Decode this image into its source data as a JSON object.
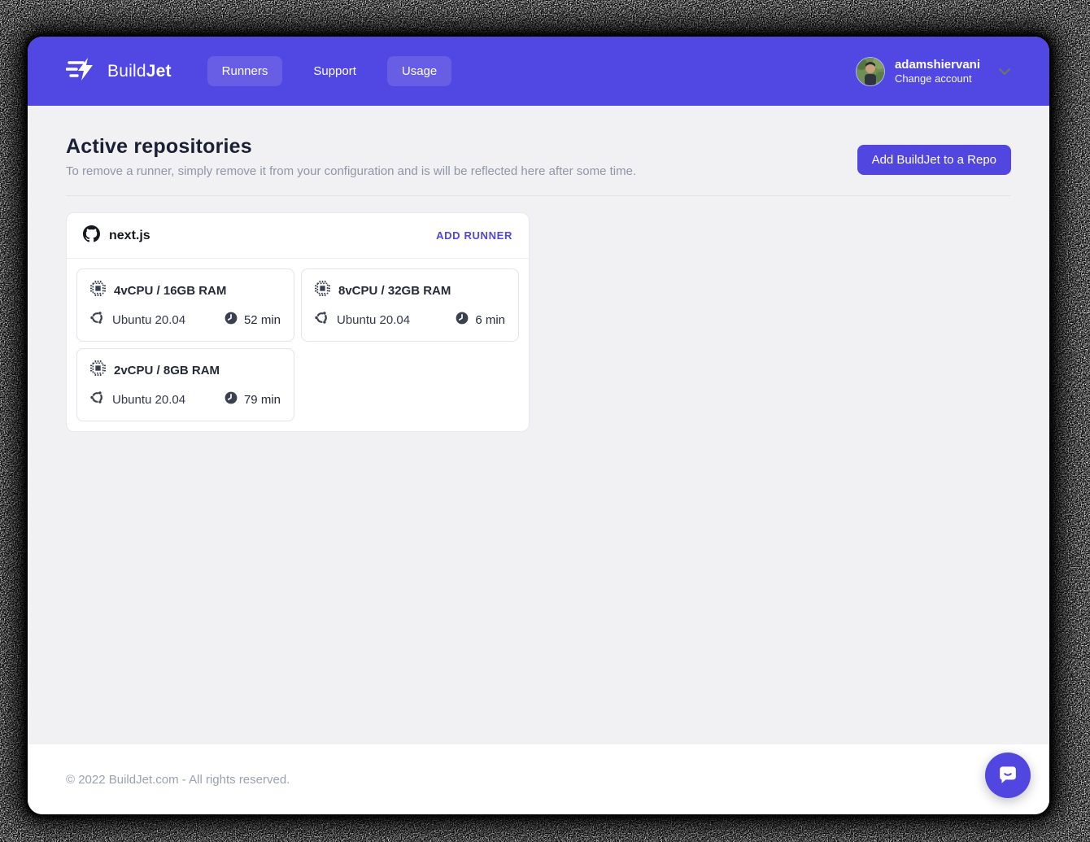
{
  "navbar": {
    "brand": {
      "light": "Build",
      "bold": "Jet"
    },
    "items": [
      {
        "label": "Runners",
        "active": true
      },
      {
        "label": "Support",
        "active": false
      },
      {
        "label": "Usage",
        "active": true
      }
    ],
    "account": {
      "username": "adamshiervani",
      "action": "Change account"
    }
  },
  "page": {
    "title": "Active repositories",
    "subtitle": "To remove a runner, simply remove it from your configuration and is will be reflected here after some time.",
    "add_repo_button": "Add BuildJet to a Repo"
  },
  "repositories": [
    {
      "name": "next.js",
      "add_runner_label": "ADD RUNNER",
      "runners": [
        {
          "specs": "4vCPU / 16GB RAM",
          "os": "Ubuntu 20.04",
          "time": "52 min"
        },
        {
          "specs": "8vCPU / 32GB RAM",
          "os": "Ubuntu 20.04",
          "time": "6 min"
        },
        {
          "specs": "2vCPU / 8GB RAM",
          "os": "Ubuntu 20.04",
          "time": "79 min"
        }
      ]
    }
  ],
  "footer": {
    "copyright": "© 2022 BuildJet.com - All rights reserved."
  },
  "colors": {
    "navbar": "#5147E2",
    "brand_button": "#5246E0",
    "accent_link": "#4F46E5",
    "page_background": "#F1F1F4",
    "heading": "#1A2033",
    "muted_text": "#8F96A7",
    "icon": "#3A4050"
  },
  "icons": {
    "logo": "buildjet-bolt-icon",
    "repo": "github-icon",
    "specs": "cpu-chip-icon",
    "os": "ubuntu-icon",
    "duration": "clock-icon",
    "account": "chevron-down-icon",
    "chat": "chat-bubble-icon"
  }
}
